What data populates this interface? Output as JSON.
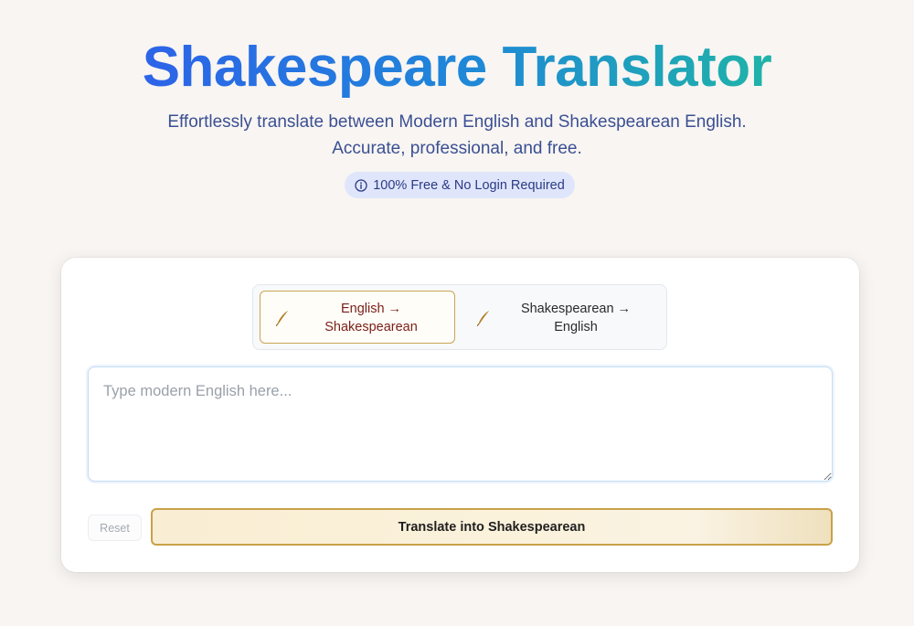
{
  "header": {
    "title_part1": "Shakespeare",
    "title_part2": "Translator",
    "subtitle_line1": "Effortlessly translate between Modern English and Shakespearean English.",
    "subtitle_line2": "Accurate, professional, and free.",
    "badge": {
      "icon": "info-circle-icon",
      "text": "100% Free & No Login Required"
    }
  },
  "translator": {
    "modes": [
      {
        "icon": "quill-icon",
        "line1": "English →",
        "line2": "Shakespearean",
        "active": true
      },
      {
        "icon": "quill-icon",
        "line1": "Shakespearean →",
        "line2": "English",
        "active": false
      }
    ],
    "input": {
      "value": "",
      "placeholder": "Type modern English here..."
    },
    "reset_label": "Reset",
    "translate_label": "Translate into Shakespearean"
  },
  "colors": {
    "background": "#f8f5f2",
    "title_gradient_start": "#2d63e8",
    "title_gradient_end": "#1fb3a8",
    "subtitle": "#3b4f93",
    "badge_bg": "#dfe6fb",
    "gold_accent": "#c9a148",
    "active_mode_text": "#7a1f17"
  }
}
